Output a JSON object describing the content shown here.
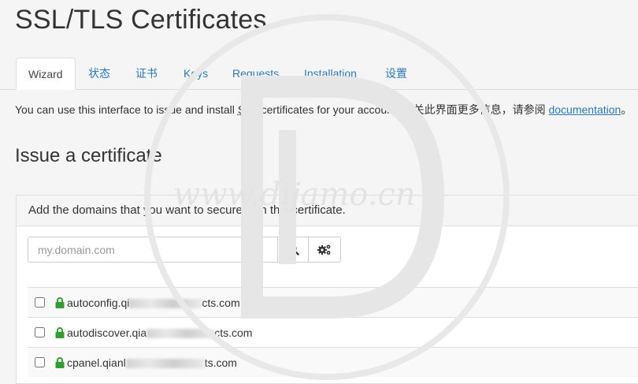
{
  "page": {
    "title": "SSL/TLS Certificates",
    "watermark_text": "www.dijamo.cn"
  },
  "tabs": [
    {
      "label": "Wizard",
      "active": true
    },
    {
      "label": "状态",
      "active": false
    },
    {
      "label": "证书",
      "active": false
    },
    {
      "label": "Keys",
      "active": false
    },
    {
      "label": "Requests",
      "active": false
    },
    {
      "label": "Installation",
      "active": false
    },
    {
      "label": "设置",
      "active": false
    }
  ],
  "intro": {
    "prefix": "You can use this interface to issue and install ",
    "abbr": "SSL",
    "middle": " certificates for your account. 有关此界面更多信息，请参阅 ",
    "link": "documentation",
    "suffix": "。"
  },
  "issue": {
    "heading": "Issue a certificate",
    "panel_heading": "Add the domains that you want to secure with this certificate.",
    "search_placeholder": "my.domain.com",
    "search_icon": "search-icon",
    "settings_icon": "cogs-icon"
  },
  "domains": [
    {
      "prefix": "autoconfig.qi",
      "suffix": "cts.com",
      "checked": false
    },
    {
      "prefix": "autodiscover.qia",
      "suffix": "cts.com",
      "checked": false
    },
    {
      "prefix": "cpanel.qianl",
      "suffix": "ts.com",
      "checked": false
    }
  ],
  "colors": {
    "link": "#2a79b4",
    "lock": "#2ea02e",
    "background": "#f5f5f5"
  }
}
